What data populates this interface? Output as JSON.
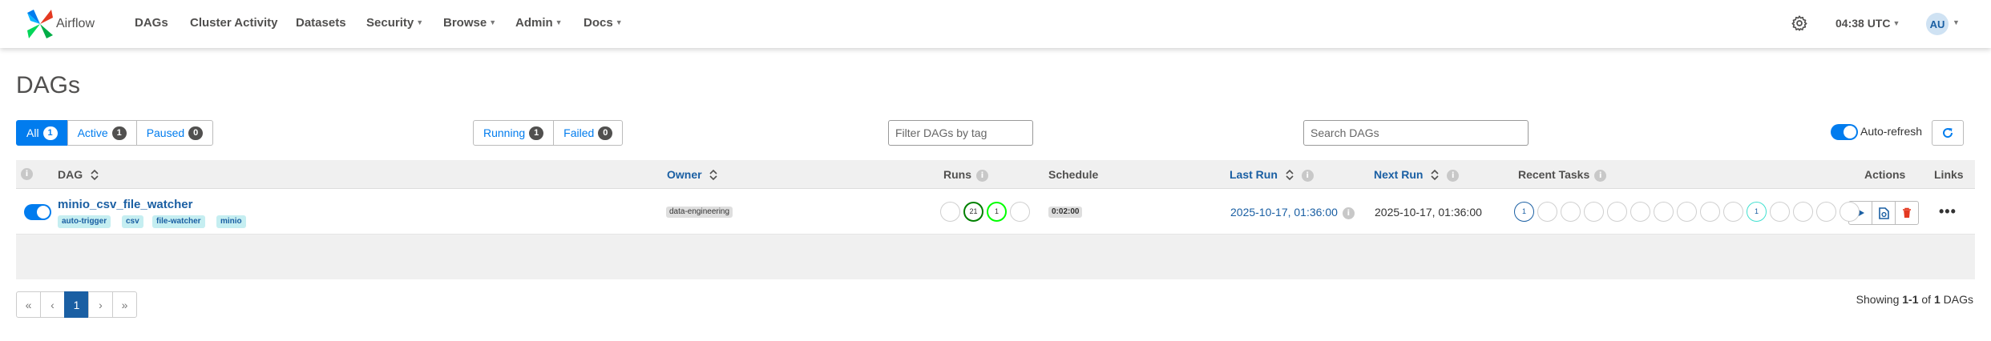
{
  "navbar": {
    "brand": "Airflow",
    "items": [
      {
        "label": "DAGs",
        "has_caret": false
      },
      {
        "label": "Cluster Activity",
        "has_caret": false
      },
      {
        "label": "Datasets",
        "has_caret": false
      },
      {
        "label": "Security",
        "has_caret": true
      },
      {
        "label": "Browse",
        "has_caret": true
      },
      {
        "label": "Admin",
        "has_caret": true
      },
      {
        "label": "Docs",
        "has_caret": true
      }
    ],
    "time": "04:38 UTC",
    "avatar_initials": "AU"
  },
  "page": {
    "title": "DAGs"
  },
  "status_filters": [
    {
      "label": "All",
      "count": "1",
      "active": true
    },
    {
      "label": "Active",
      "count": "1",
      "active": false
    },
    {
      "label": "Paused",
      "count": "0",
      "active": false
    }
  ],
  "run_filters": [
    {
      "label": "Running",
      "count": "1"
    },
    {
      "label": "Failed",
      "count": "0"
    }
  ],
  "tag_filter": {
    "placeholder": "Filter DAGs by tag"
  },
  "search": {
    "placeholder": "Search DAGs"
  },
  "auto_refresh": {
    "label": "Auto-refresh",
    "enabled": true
  },
  "table": {
    "columns": {
      "dag": "DAG",
      "owner": "Owner",
      "runs": "Runs",
      "schedule": "Schedule",
      "last_run": "Last Run",
      "next_run": "Next Run",
      "recent_tasks": "Recent Tasks",
      "actions": "Actions",
      "links": "Links"
    },
    "row": {
      "dag_id": "minio_csv_file_watcher",
      "paused": false,
      "tags": [
        "auto-trigger",
        "csv",
        "file-watcher",
        "minio"
      ],
      "owner": "data-engineering",
      "runs": [
        {
          "count": "",
          "state": "queued"
        },
        {
          "count": "21",
          "state": "success"
        },
        {
          "count": "1",
          "state": "running"
        },
        {
          "count": "",
          "state": "failed"
        }
      ],
      "schedule": "0:02:00",
      "last_run": "2025-10-17, 01:36:00",
      "next_run": "2025-10-17, 01:36:00",
      "recent_tasks": [
        "1",
        "",
        "",
        "",
        "",
        "",
        "",
        "",
        "",
        "",
        "1",
        "",
        "",
        "",
        ""
      ],
      "links_label": "•••"
    }
  },
  "pagination": {
    "first": "«",
    "prev": "‹",
    "current": "1",
    "next": "›",
    "last": "»"
  },
  "showing": {
    "prefix": "Showing ",
    "range": "1-1",
    "middle": " of ",
    "total": "1",
    "suffix": " DAGs"
  },
  "colors": {
    "accent": "#017cee",
    "link": "#1a5fa3",
    "success": "#008000",
    "running": "#00ff00",
    "tag_bg": "#c5eef1",
    "task_ring": "#40e0d0",
    "delete": "#e43921"
  }
}
